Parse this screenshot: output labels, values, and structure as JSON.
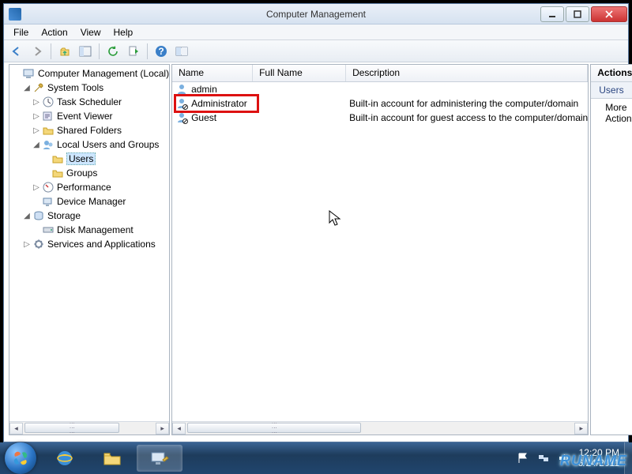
{
  "window": {
    "title": "Computer Management"
  },
  "menu": {
    "file": "File",
    "action": "Action",
    "view": "View",
    "help": "Help"
  },
  "tree": {
    "root": "Computer Management (Local)",
    "system_tools": "System Tools",
    "task_scheduler": "Task Scheduler",
    "event_viewer": "Event Viewer",
    "shared_folders": "Shared Folders",
    "local_users": "Local Users and Groups",
    "users": "Users",
    "groups": "Groups",
    "performance": "Performance",
    "device_manager": "Device Manager",
    "storage": "Storage",
    "disk_management": "Disk Management",
    "services_apps": "Services and Applications"
  },
  "list": {
    "headers": {
      "name": "Name",
      "full": "Full Name",
      "desc": "Description"
    },
    "rows": [
      {
        "name": "admin",
        "full": "",
        "desc": ""
      },
      {
        "name": "Administrator",
        "full": "",
        "desc": "Built-in account for administering the computer/domain"
      },
      {
        "name": "Guest",
        "full": "",
        "desc": "Built-in account for guest access to the computer/domain"
      }
    ]
  },
  "actions": {
    "header": "Actions",
    "section": "Users",
    "more": "More Actions"
  },
  "taskbar": {
    "time": "12:20 PM",
    "date": "6/24/2011"
  },
  "watermark": "RUNAME"
}
